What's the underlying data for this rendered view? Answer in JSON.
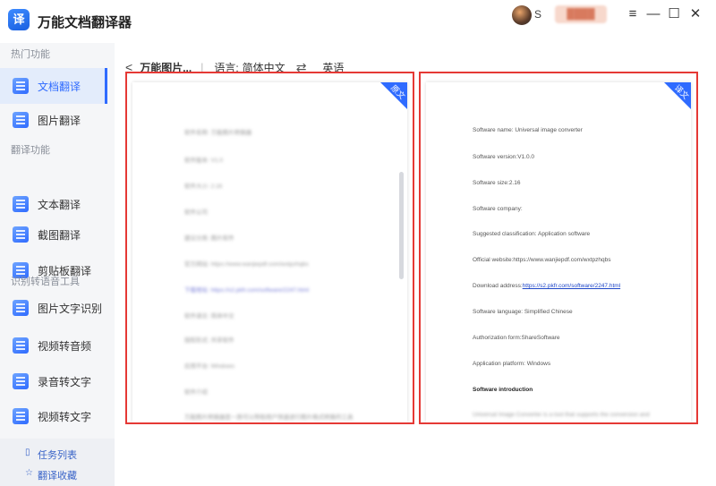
{
  "app": {
    "logo_text": "译",
    "title": "万能文档翻译器"
  },
  "titlebar": {
    "user_initial": "S",
    "vip_badge": "████",
    "menu_icon": "≡",
    "minimize_icon": "—",
    "maximize_icon": "☐",
    "close_icon": "✕"
  },
  "sidebar": {
    "sections": [
      {
        "title": "热门功能",
        "items": [
          {
            "label": "文档翻译",
            "active": true
          },
          {
            "label": "图片翻译"
          }
        ]
      },
      {
        "title": "翻译功能",
        "items": [
          {
            "label": "文本翻译"
          },
          {
            "label": "截图翻译"
          },
          {
            "label": "剪贴板翻译"
          }
        ]
      },
      {
        "title": "识别转语音工具",
        "items": [
          {
            "label": "图片文字识别"
          },
          {
            "label": "视频转音频"
          },
          {
            "label": "录音转文字"
          },
          {
            "label": "视频转文字"
          }
        ]
      }
    ],
    "bottom_links": [
      {
        "label": "任务列表",
        "icon": "▯"
      },
      {
        "label": "翻译收藏",
        "icon": "☆"
      }
    ]
  },
  "breadcrumb": {
    "back_icon": "<",
    "title": "万能图片...",
    "sep": "|",
    "lang_label": "语言:",
    "source_lang": "简体中文",
    "swap_icon": "⇄",
    "target_lang": "英语"
  },
  "panels": {
    "original": {
      "tag": "原文",
      "lines": [
        {
          "text": "软件名称: 万能图片转换器",
          "blur": true
        },
        {
          "text": "软件版本: V1.0",
          "blur": true
        },
        {
          "text": "软件大小: 2.16",
          "blur": true
        },
        {
          "text": "软件公司",
          "blur": true
        },
        {
          "text": "建议分类: 图片软件",
          "blur": true
        },
        {
          "text": "官方网站: https://www.wanjiepdf.com/wxtpzhqbs",
          "blur": true
        },
        {
          "text": "下载地址: https://s2.pkfr.com/software/2247.html",
          "blur": true
        },
        {
          "text": "软件语言: 简体中文",
          "blur": true
        },
        {
          "text": "授权形式: 共享软件",
          "blur": true
        },
        {
          "text": "应用平台: Windows",
          "blur": true
        },
        {
          "text": "软件介绍",
          "blur": true
        },
        {
          "text": "万能图片转换器是一款可以帮助用户快速进行图片格式转换的工具",
          "blur": true
        }
      ]
    },
    "translation": {
      "tag": "译文",
      "lines": [
        {
          "text": "Software name: Universal image converter"
        },
        {
          "text": "Software version:V1.0.0"
        },
        {
          "text": "Software size:2.16"
        },
        {
          "text": "Software company:"
        },
        {
          "text": "Suggested classification: Application software"
        },
        {
          "text": "Official website:https://www.wanjiepdf.com/wxtpzhqbs"
        },
        {
          "text": "Download address:",
          "link": "https://s2.pkfr.com/software/2247.html"
        },
        {
          "text": "Software language: Simplified Chinese"
        },
        {
          "text": "Authorization form:ShareSoftware"
        },
        {
          "text": "Application platform: Windows"
        },
        {
          "text": "Software introduction",
          "bold": true
        },
        {
          "text": "Universal Image Converter is a tool that supports the conversion and",
          "blur": true
        }
      ]
    }
  },
  "colors": {
    "accent": "#2f6bff",
    "highlight_border": "#e53935"
  }
}
